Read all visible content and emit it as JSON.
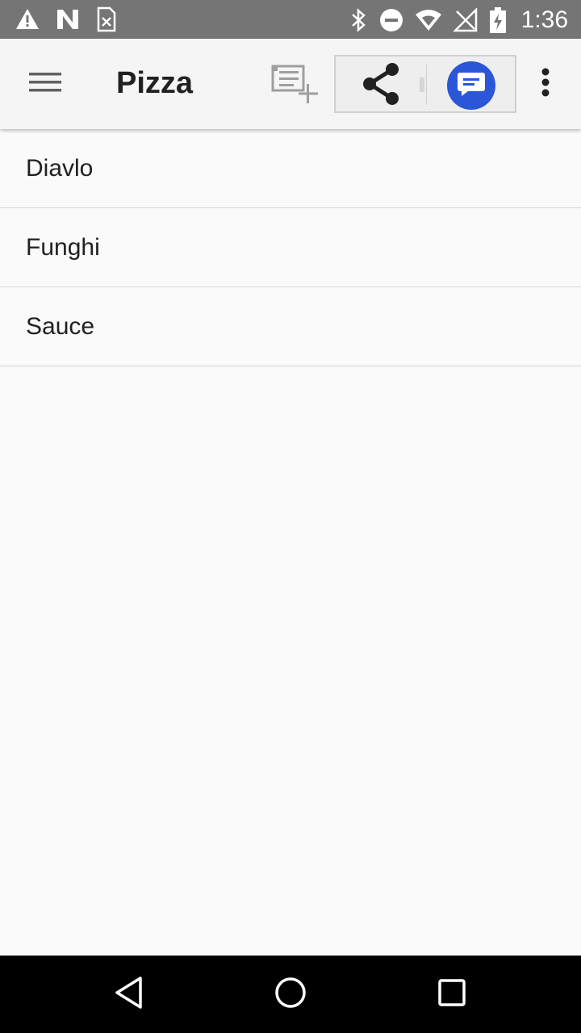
{
  "status_bar": {
    "time": "1:36",
    "left_icons": [
      "warning-icon",
      "n-logo-icon",
      "sim-off-icon"
    ],
    "right_icons": [
      "bluetooth-icon",
      "do-not-disturb-icon",
      "wifi-icon",
      "no-signal-icon",
      "battery-charging-icon"
    ]
  },
  "app_bar": {
    "title": "Pizza",
    "icons": [
      "menu-icon",
      "add-to-list-icon",
      "share-icon",
      "messages-icon",
      "more-vert-icon"
    ]
  },
  "list": {
    "items": [
      "Diavlo",
      "Funghi",
      "Sauce"
    ]
  },
  "nav_bar": {
    "icons": [
      "back-icon",
      "home-icon",
      "recents-icon"
    ]
  },
  "colors": {
    "status_bar": "#757575",
    "app_bar": "#f5f5f5",
    "background": "#fafafa",
    "messages_accent": "#2b56d8",
    "nav_bar": "#000000"
  }
}
